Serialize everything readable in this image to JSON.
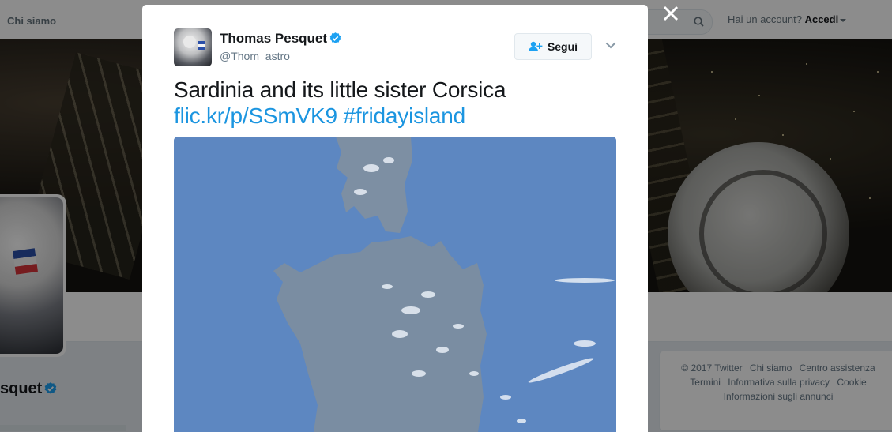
{
  "topbar": {
    "about_label": "Chi siamo",
    "account_prompt": "Hai un account?",
    "login_label": "Accedi"
  },
  "profile": {
    "name_partial": "squet"
  },
  "footer": {
    "links": [
      "© 2017 Twitter",
      "Chi siamo",
      "Centro assistenza",
      "Termini",
      "Informativa sulla privacy",
      "Cookie",
      "Informazioni sugli annunci"
    ]
  },
  "tweet": {
    "author_name": "Thomas Pesquet",
    "author_handle": "@Thom_astro",
    "follow_label": "Segui",
    "text": "Sardinia and its little sister Corsica",
    "link": "flic.kr/p/SSmVK9",
    "hashtag": "#fridayisland"
  },
  "colors": {
    "brand_blue": "#1da1f2",
    "link_blue": "#1b95e0",
    "sea": "#5d87c1"
  }
}
